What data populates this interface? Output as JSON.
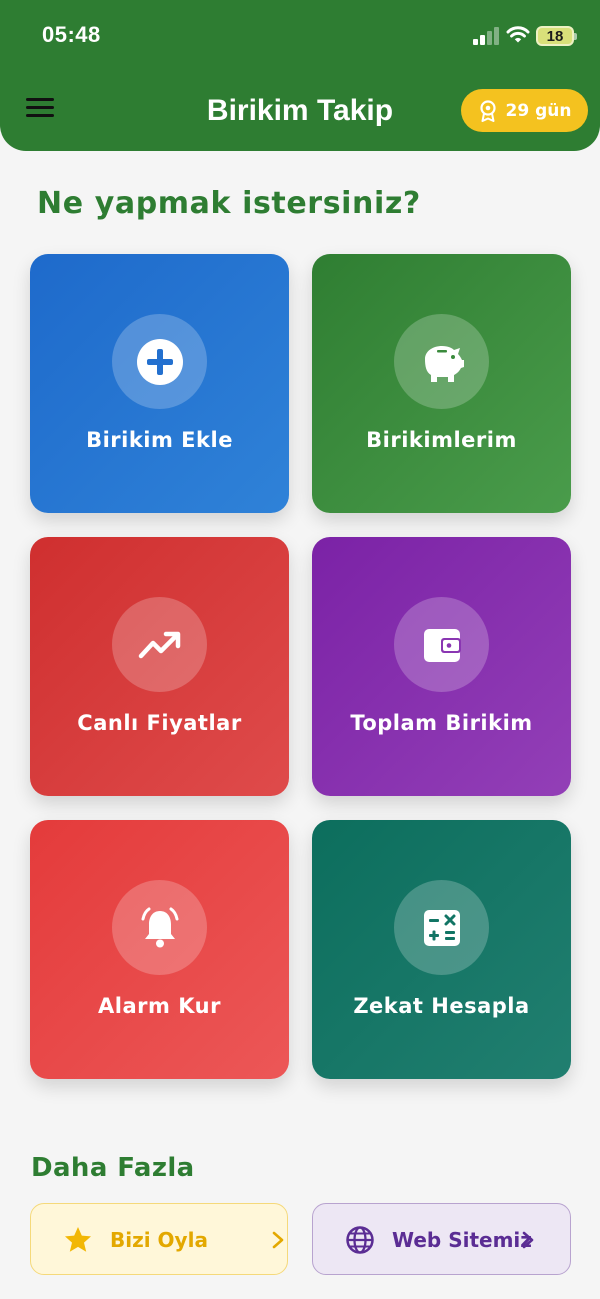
{
  "status_bar": {
    "time": "05:48",
    "battery": "18"
  },
  "header": {
    "title": "Birikim Takip",
    "streak": "29 gün",
    "color": "#2e7d32"
  },
  "main": {
    "question": "Ne yapmak istersiniz?",
    "tiles": [
      {
        "label": "Birikim Ekle",
        "icon": "plus-circle-icon",
        "color": "#1e6acb"
      },
      {
        "label": "Birikimlerim",
        "icon": "piggy-bank-icon",
        "color": "#2f7e32"
      },
      {
        "label": "Canlı Fiyatlar",
        "icon": "trending-up-icon",
        "color": "#cf2f2f"
      },
      {
        "label": "Toplam Birikim",
        "icon": "wallet-icon",
        "color": "#7b22a6"
      },
      {
        "label": "Alarm Kur",
        "icon": "bell-icon",
        "color": "#e43b3b"
      },
      {
        "label": "Zekat Hesapla",
        "icon": "calculator-icon",
        "color": "#0c6e5d"
      }
    ]
  },
  "more": {
    "title": "Daha Fazla",
    "rate_label": "Bizi Oyla",
    "rate_icon": "star-icon",
    "web_label": "Web Sitemiz",
    "web_icon": "globe-icon",
    "chevron_icon": "chevron-right-icon"
  }
}
